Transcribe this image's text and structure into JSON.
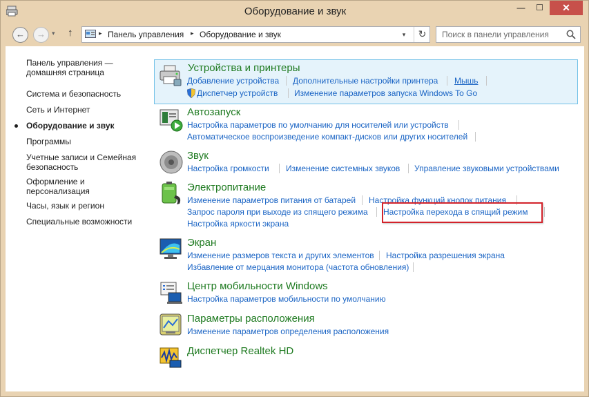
{
  "window": {
    "title": "Оборудование и звук",
    "close_glyph": "✕",
    "min_glyph": "—",
    "max_glyph": "☐"
  },
  "nav": {
    "back_glyph": "←",
    "forward_glyph": "→",
    "recent_glyph": "▾",
    "up_glyph": "↑",
    "breadcrumb": [
      "Панель управления",
      "Оборудование и звук"
    ],
    "breadcrumb_sep": "▸",
    "dropdown_glyph": "▾",
    "refresh_glyph": "↻",
    "search_placeholder": "Поиск в панели управления"
  },
  "sidebar": {
    "items": [
      {
        "label": "Панель управления — домашняя страница"
      },
      {
        "label": "Система и безопасность"
      },
      {
        "label": "Сеть и Интернет"
      },
      {
        "label": "Оборудование и звук",
        "active": true
      },
      {
        "label": "Программы"
      },
      {
        "label": "Учетные записи и Семейная безопасность"
      },
      {
        "label": "Оформление и персонализация"
      },
      {
        "label": "Часы, язык и регион"
      },
      {
        "label": "Специальные возможности"
      }
    ]
  },
  "categories": {
    "devices": {
      "title": "Устройства и принтеры",
      "links": [
        "Добавление устройства",
        "Дополнительные настройки принтера",
        "Мышь",
        "Диспетчер устройств",
        "Изменение параметров запуска Windows To Go"
      ]
    },
    "autoplay": {
      "title": "Автозапуск",
      "links": [
        "Настройка параметров по умолчанию для носителей или устройств",
        "Автоматическое воспроизведение компакт-дисков или других носителей"
      ]
    },
    "sound": {
      "title": "Звук",
      "links": [
        "Настройка громкости",
        "Изменение системных звуков",
        "Управление звуковыми устройствами"
      ]
    },
    "power": {
      "title": "Электропитание",
      "links": [
        "Изменение параметров питания от батарей",
        "Настройка функций кнопок питания",
        "Запрос пароля при выходе из спящего режима",
        "Настройка перехода в спящий режим",
        "Настройка яркости экрана"
      ]
    },
    "display": {
      "title": "Экран",
      "links": [
        "Изменение размеров текста и других элементов",
        "Настройка разрешения экрана",
        "Избавление от мерцания монитора (частота обновления)"
      ]
    },
    "mobility": {
      "title": "Центр мобильности Windows",
      "links": [
        "Настройка параметров мобильности по умолчанию"
      ]
    },
    "location": {
      "title": "Параметры расположения",
      "links": [
        "Изменение параметров определения расположения"
      ]
    },
    "realtek": {
      "title": "Диспетчер Realtek HD"
    }
  },
  "colors": {
    "accent_link": "#1a64c4",
    "category_title": "#1e7a20",
    "highlight_bg": "#e5f3fb",
    "highlight_border": "#70c0e7",
    "annotation_box": "#d3232b",
    "frame": "#e9d3b2"
  }
}
